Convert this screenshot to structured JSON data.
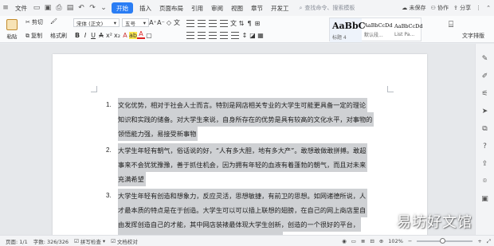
{
  "menubar": {
    "file": "文件",
    "tabs": [
      "开始",
      "插入",
      "页面布局",
      "引用",
      "审阅",
      "视图",
      "章节",
      "开发工"
    ],
    "active_tab": "开始",
    "search_placeholder": "查找命令、搜索模板",
    "unsaved": "未保存",
    "collab": "协作",
    "share": "分享"
  },
  "ribbon": {
    "paste": "粘贴",
    "cut": "剪切",
    "copy": "复制",
    "format_painter": "格式刷",
    "font_name": "宋体 (正文)",
    "font_size": "五号",
    "styles": [
      {
        "preview": "AaBbC",
        "name": "标题 4"
      },
      {
        "preview": "AaBbCcDd",
        "name": "默认段..."
      },
      {
        "preview": "AaBbCcDd",
        "name": "List Pa..."
      }
    ],
    "text_layout": "文字排版"
  },
  "document": {
    "items": [
      {
        "num": "1.",
        "lines": [
          "文化优势，相对于社会人士而言。特别是网店相关专业的大学生可能更具备一定的理论",
          "知识和实践的储备。对大学生来说，自身所存在的优势是具有较高的文化水平，对事物的",
          "领悟能力强，易接受新事物"
        ]
      },
      {
        "num": "2.",
        "lines": [
          "大学生年轻有朝气，俗话说的好，“人有多大胆，地有多大产”。敢想敢做敢拼搏。敢超",
          "事来不会犹犹豫豫，善于抓住机会，因为拥有年轻的血液有着蓬勃的朝气，而且对未来",
          "充满希望"
        ]
      },
      {
        "num": "3.",
        "lines": [
          "大学生年轻有创造和想象力，反应灵活，思想敏捷，有前卫的思想。如网诸德所说，人",
          "才最本质的特点是在于创造。大学生可以可以插上联想的翅膀，在自己的网上商店里自",
          "由发挥创造自己的才能，其中网店装裱最体现大学生创新，创造的一个很好的平台，",
          "如果网店装修的很有新意，就可以在众多网店脱颖而出。"
        ]
      }
    ]
  },
  "watermark": "易坊好文馆",
  "statusbar": {
    "page": "页面: 1/1",
    "words": "字数: 326/326",
    "spellcheck": "拼写检查",
    "proof": "文档校对",
    "zoom": "102%",
    "zoom_fraction": 0.45
  }
}
